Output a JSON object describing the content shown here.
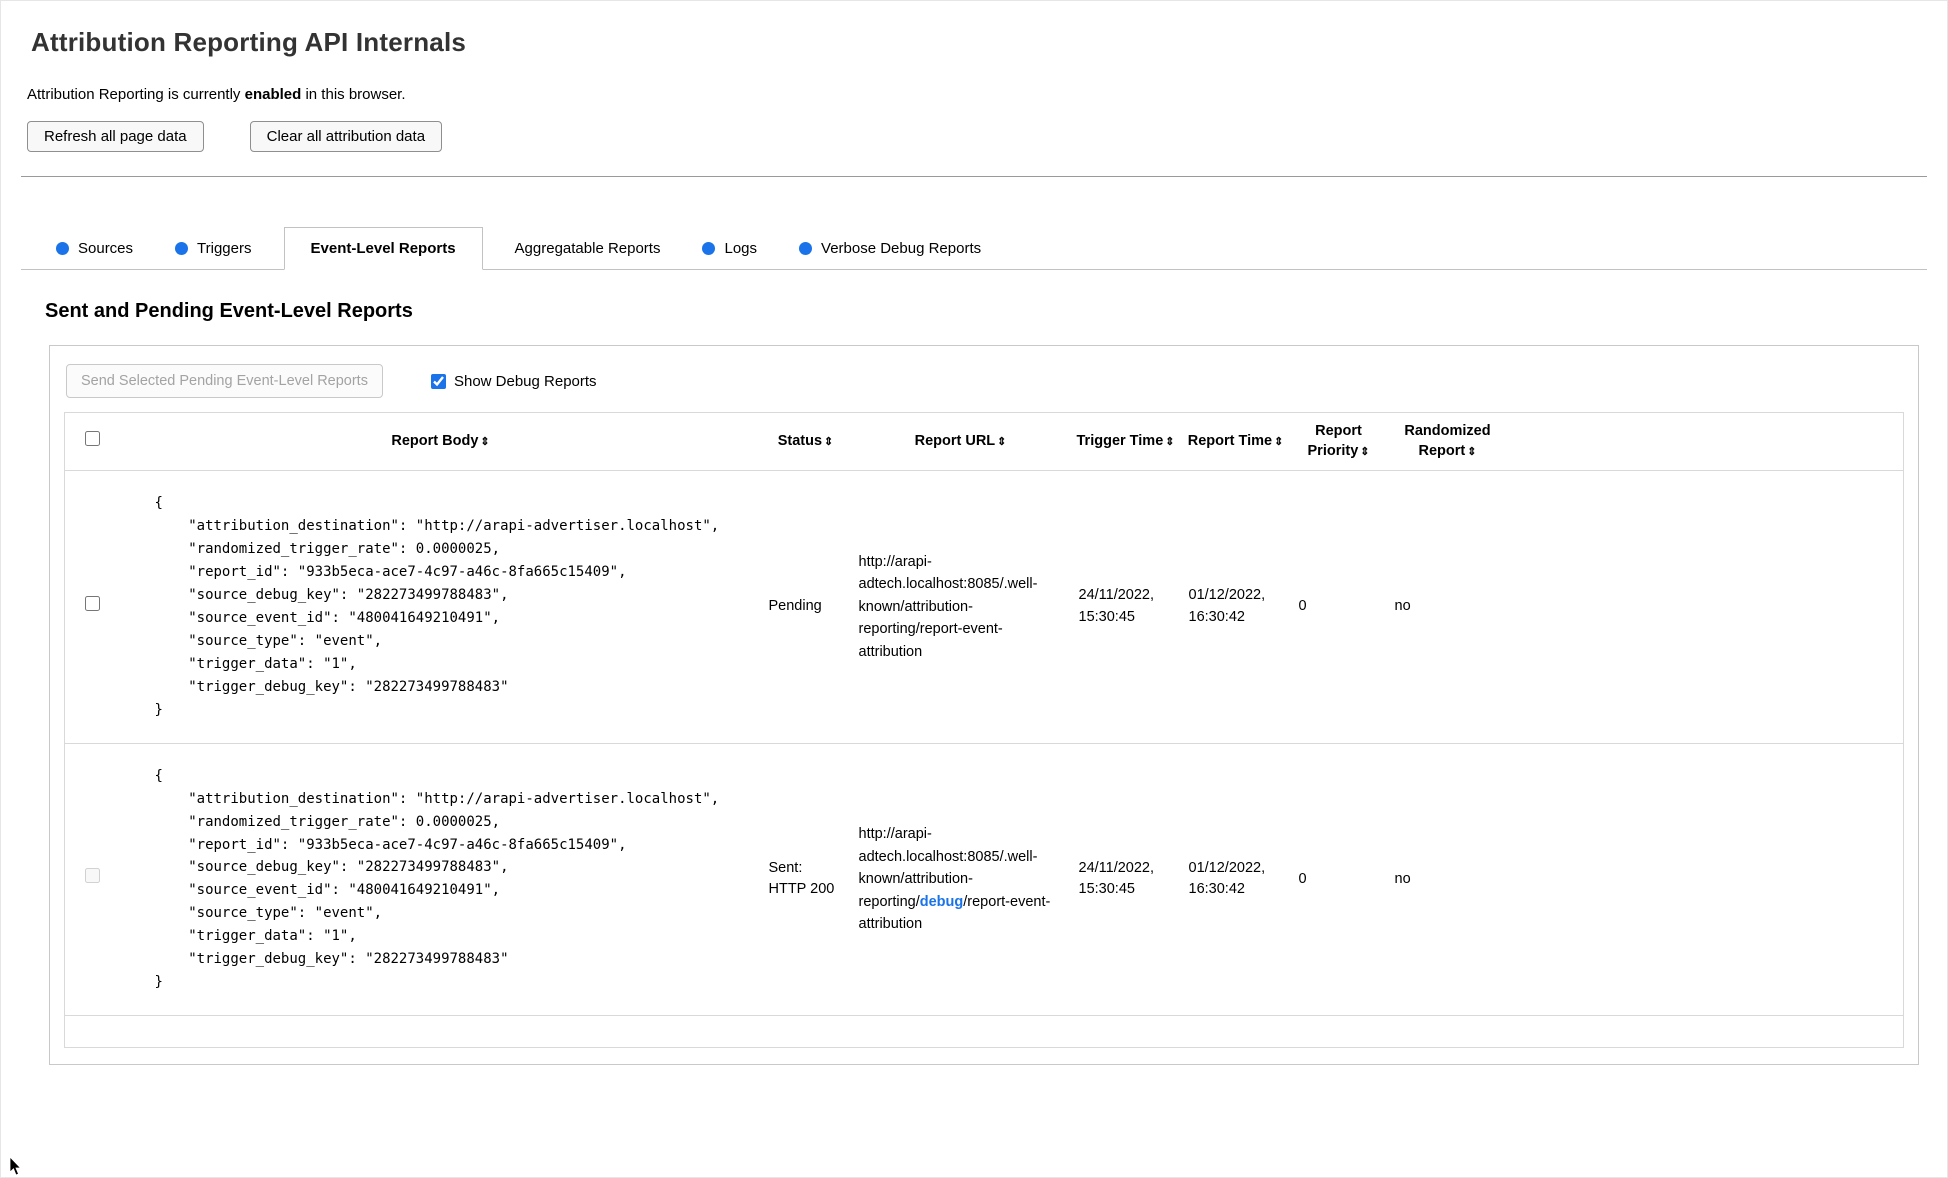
{
  "colors": {
    "accent": "#1a73e8"
  },
  "page": {
    "title": "Attribution Reporting API Internals",
    "status_prefix": "Attribution Reporting is currently ",
    "status_bold": "enabled",
    "status_suffix": " in this browser.",
    "refresh_button_label": "Refresh all page data",
    "clear_button_label": "Clear all attribution data"
  },
  "tabs": [
    "Sources",
    "Triggers",
    "Event-Level Reports",
    "Aggregatable Reports",
    "Logs",
    "Verbose Debug Reports"
  ],
  "section": {
    "heading": "Sent and Pending Event-Level Reports",
    "send_button_label": "Send Selected Pending Event-Level Reports",
    "show_debug_label": "Show Debug Reports"
  },
  "table": {
    "sort_icon": "⇕",
    "headers": [
      "Report Body",
      "Status",
      "Report URL",
      "Trigger Time",
      "Report Time",
      "Report Priority",
      "Randomized Report"
    ],
    "rows": [
      {
        "report_body": "{\n    \"attribution_destination\": \"http://arapi-advertiser.localhost\",\n    \"randomized_trigger_rate\": 0.0000025,\n    \"report_id\": \"933b5eca-ace7-4c97-a46c-8fa665c15409\",\n    \"source_debug_key\": \"282273499788483\",\n    \"source_event_id\": \"480041649210491\",\n    \"source_type\": \"event\",\n    \"trigger_data\": \"1\",\n    \"trigger_debug_key\": \"282273499788483\"\n}",
        "status": "Pending",
        "url_before": "http://arapi-adtech.localhost:8085/.well-known/attribution-reporting/report-event-attribution",
        "url_debug": "",
        "url_after": "",
        "trigger_time": "24/11/2022, 15:30:45",
        "report_time": "01/12/2022, 16:30:42",
        "report_priority": "0",
        "randomized_report": "no"
      },
      {
        "report_body": "{\n    \"attribution_destination\": \"http://arapi-advertiser.localhost\",\n    \"randomized_trigger_rate\": 0.0000025,\n    \"report_id\": \"933b5eca-ace7-4c97-a46c-8fa665c15409\",\n    \"source_debug_key\": \"282273499788483\",\n    \"source_event_id\": \"480041649210491\",\n    \"source_type\": \"event\",\n    \"trigger_data\": \"1\",\n    \"trigger_debug_key\": \"282273499788483\"\n}",
        "status": "Sent: HTTP 200",
        "url_before": "http://arapi-adtech.localhost:8085/.well-known/attribution-reporting/",
        "url_debug": "debug",
        "url_after": "/report-event-attribution",
        "trigger_time": "24/11/2022, 15:30:45",
        "report_time": "01/12/2022, 16:30:42",
        "report_priority": "0",
        "randomized_report": "no"
      }
    ]
  }
}
